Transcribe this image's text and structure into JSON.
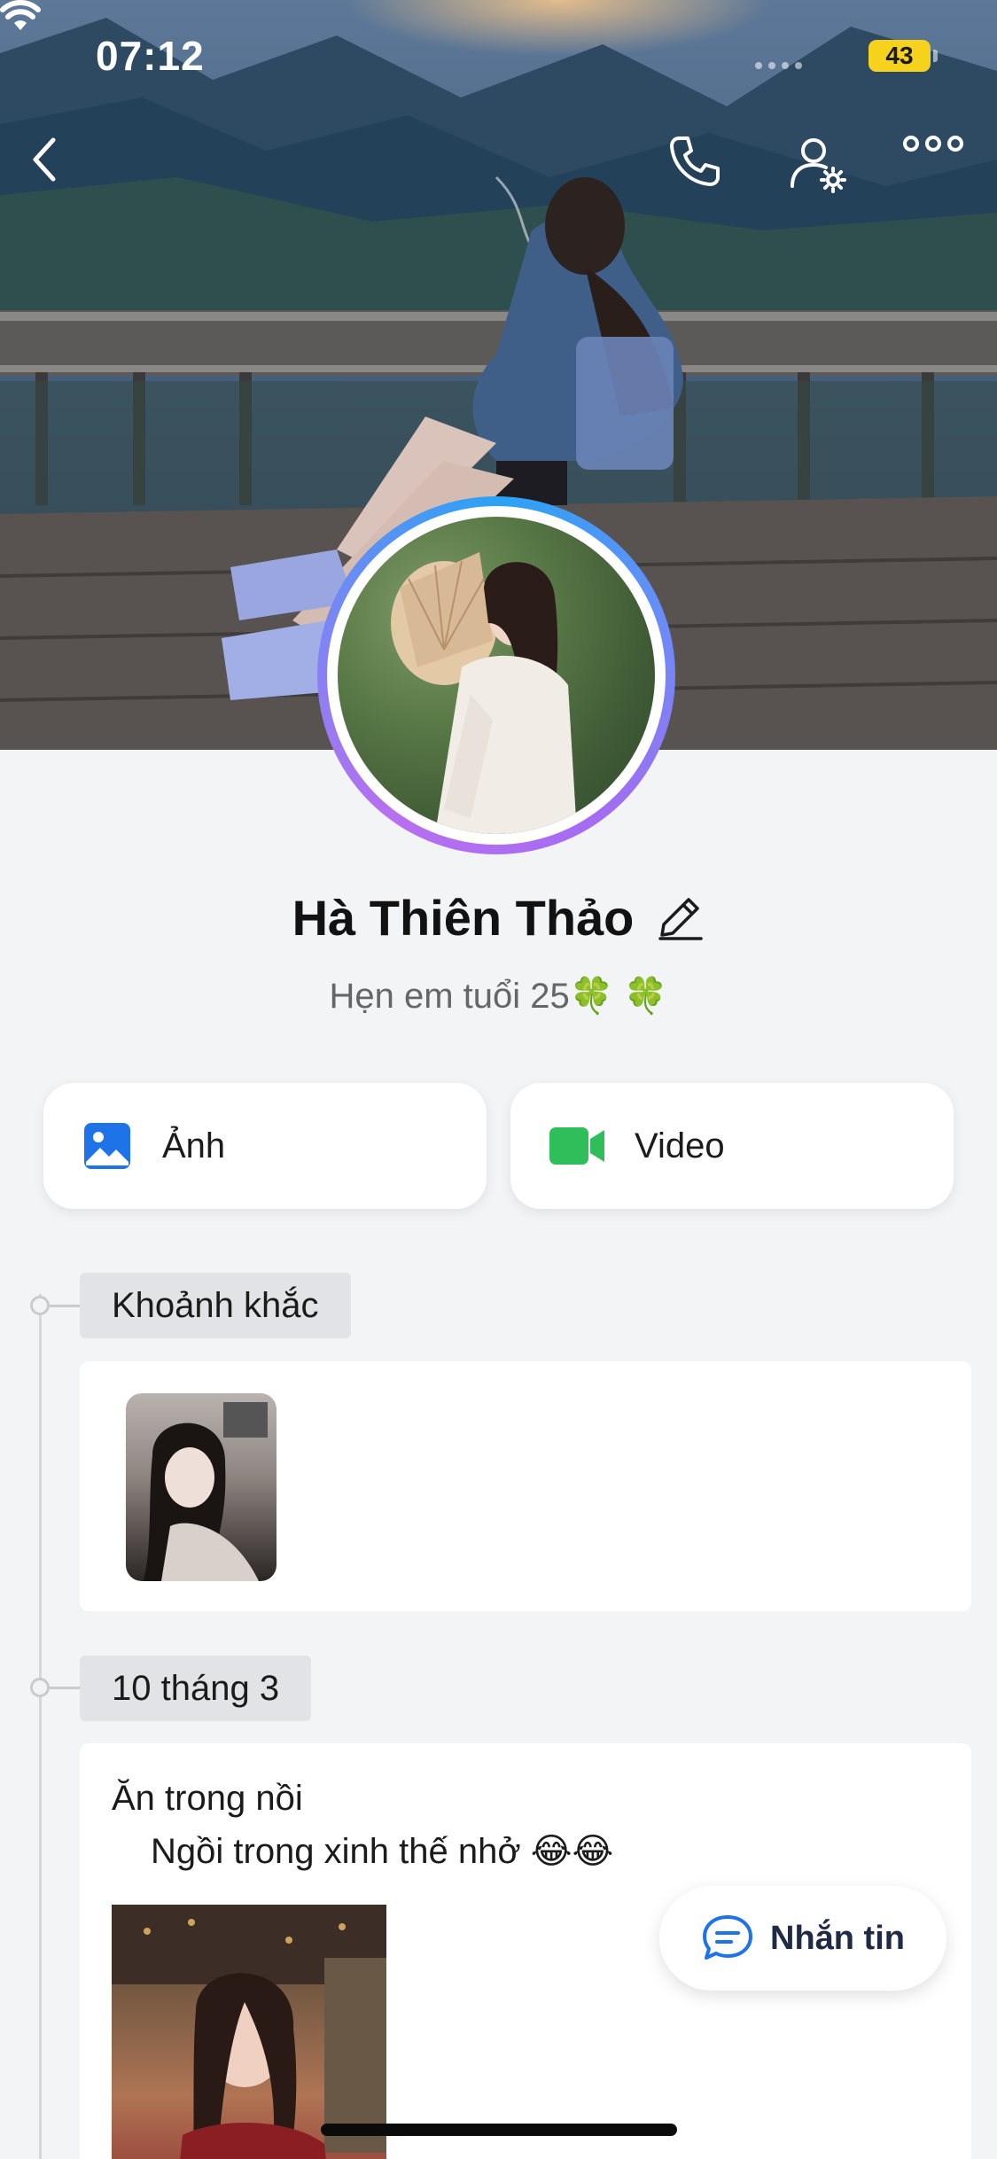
{
  "status_bar": {
    "time": "07:12",
    "battery": "43"
  },
  "header": {
    "back_icon": "chevron-left-icon",
    "call_icon": "phone-icon",
    "settings_icon": "user-settings-icon",
    "more_icon": "more-horizontal-icon"
  },
  "profile": {
    "name": "Hà Thiên Thảo",
    "bio": "Hẹn em tuổi 25",
    "bio_emoji": "🍀 🍀"
  },
  "actions": {
    "photos_label": "Ảnh",
    "video_label": "Video"
  },
  "timeline": {
    "moments_label": "Khoảnh khắc",
    "post_date": "10 tháng 3",
    "post_line1": "Ăn trong nồi",
    "post_line2": "Ngồi trong xinh thế nhở",
    "post_emoji": "😂😂"
  },
  "message_button": {
    "label": "Nhắn tin"
  },
  "colors": {
    "accent_blue": "#1e73e8",
    "video_green": "#2fbe5a",
    "page_bg": "#f3f4f6"
  }
}
